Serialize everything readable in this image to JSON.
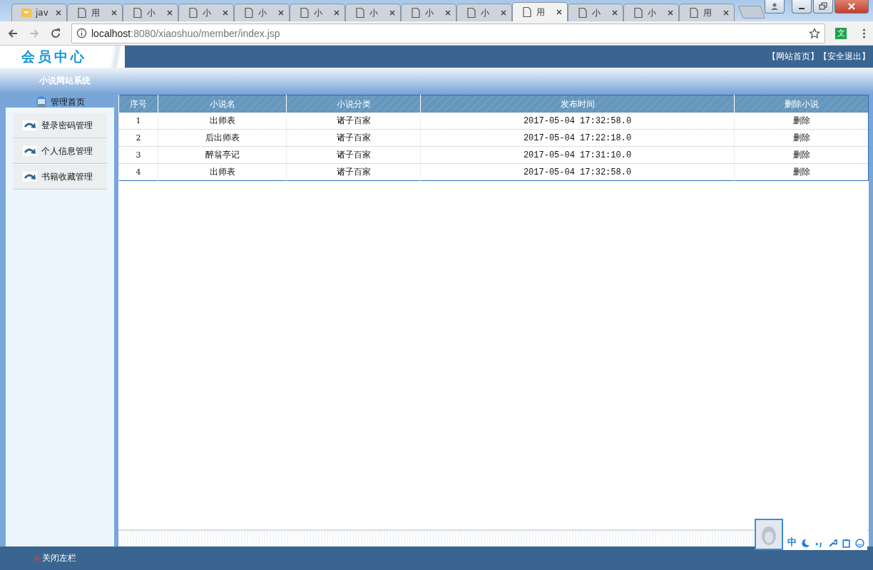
{
  "browser": {
    "tabs": [
      {
        "title": "jav",
        "selected": false,
        "kind": "site"
      },
      {
        "title": "用",
        "selected": false,
        "kind": "page"
      },
      {
        "title": "小",
        "selected": false,
        "kind": "page"
      },
      {
        "title": "小",
        "selected": false,
        "kind": "page"
      },
      {
        "title": "小",
        "selected": false,
        "kind": "page"
      },
      {
        "title": "小",
        "selected": false,
        "kind": "page"
      },
      {
        "title": "小",
        "selected": false,
        "kind": "page"
      },
      {
        "title": "小",
        "selected": false,
        "kind": "page"
      },
      {
        "title": "小",
        "selected": false,
        "kind": "page"
      },
      {
        "title": "用",
        "selected": true,
        "kind": "page"
      },
      {
        "title": "小",
        "selected": false,
        "kind": "page"
      },
      {
        "title": "小",
        "selected": false,
        "kind": "page"
      },
      {
        "title": "用",
        "selected": false,
        "kind": "page"
      }
    ],
    "url_host": "localhost",
    "url_path": ":8080/xiaoshuo/member/index.jsp",
    "extension_badge": "文"
  },
  "header": {
    "logo": "会员中心",
    "links": [
      "【网站首页】",
      "【安全退出】"
    ],
    "system_name": "小说网站系统"
  },
  "sidebar": {
    "home": "管理首页",
    "items": [
      "登录密码管理",
      "个人信息管理",
      "书籍收藏管理"
    ]
  },
  "table": {
    "columns": [
      "序号",
      "小说名",
      "小说分类",
      "发布时间",
      "删除小说"
    ],
    "rows": [
      {
        "index": "1",
        "name": "出师表",
        "category": "诸子百家",
        "time": "2017-05-04 17:32:58.0",
        "action": "删除"
      },
      {
        "index": "2",
        "name": "后出师表",
        "category": "诸子百家",
        "time": "2017-05-04 17:22:18.0",
        "action": "删除"
      },
      {
        "index": "3",
        "name": "醉翁亭记",
        "category": "诸子百家",
        "time": "2017-05-04 17:31:10.0",
        "action": "删除"
      },
      {
        "index": "4",
        "name": "出师表",
        "category": "诸子百家",
        "time": "2017-05-04 17:32:58.0",
        "action": "删除"
      }
    ]
  },
  "footer": {
    "close_sidebar": "关闭左栏"
  },
  "ime_toolbar": {
    "mode": "中"
  }
}
